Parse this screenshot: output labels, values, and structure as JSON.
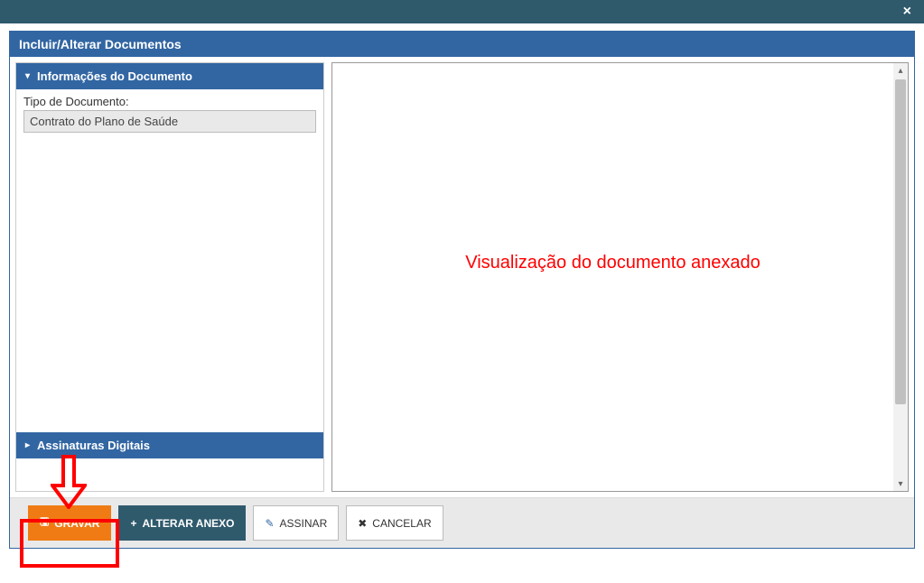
{
  "window": {
    "title": "Incluir/Alterar Documentos",
    "close_icon": "×"
  },
  "left_panel": {
    "info_header": "Informações do Documento",
    "info_expand_icon": "▾",
    "doc_type_label": "Tipo de Documento:",
    "doc_type_value": "Contrato do Plano de Saúde",
    "signatures_header": "Assinaturas Digitais",
    "signatures_expand_icon": "▸"
  },
  "preview": {
    "overlay_text": "Visualização do documento anexado"
  },
  "actions": {
    "save_label": "GRAVAR",
    "save_icon": "🖫",
    "change_attachment_label": "ALTERAR ANEXO",
    "change_attachment_icon": "+",
    "sign_label": "ASSINAR",
    "sign_icon": "✎",
    "cancel_label": "CANCELAR",
    "cancel_icon": "✖"
  }
}
